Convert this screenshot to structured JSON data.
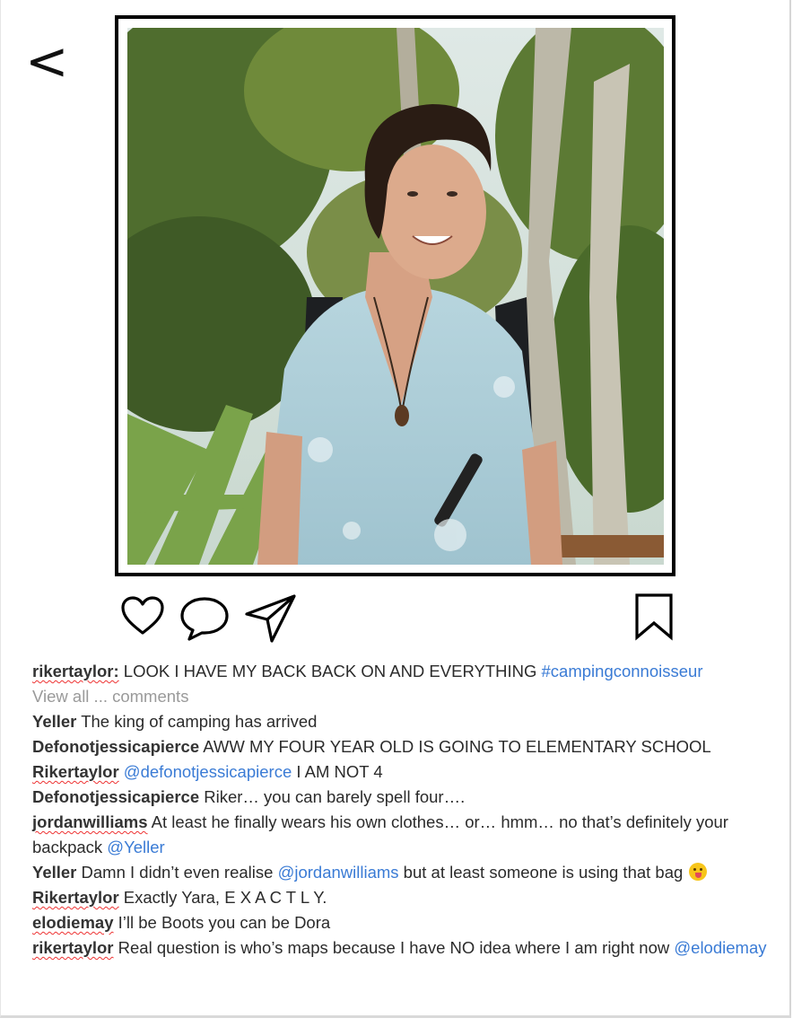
{
  "nav": {
    "back_label": "<"
  },
  "photo": {
    "subject": "Smiling man in a light blue floral shirt with a backpack in front of trees"
  },
  "actions": {
    "like_icon": "heart-icon",
    "comment_icon": "comment-bubble-icon",
    "share_icon": "paper-plane-icon",
    "save_icon": "bookmark-icon"
  },
  "caption": {
    "username": "rikertaylor:",
    "text": " LOOK I HAVE MY BACK BACK ON AND EVERYTHING ",
    "hashtag": "#campingconnoisseur"
  },
  "view_all": "View all ... comments",
  "comments": [
    {
      "user": "Yeller",
      "parts": [
        {
          "t": " The king of camping has arrived"
        }
      ]
    },
    {
      "user": "Defonotjessicapierce",
      "parts": [
        {
          "t": " AWW MY FOUR YEAR OLD IS GOING TO ELEMENTARY SCHOOL"
        }
      ]
    },
    {
      "user": "Rikertaylor",
      "parts": [
        {
          "t": " "
        },
        {
          "m": "@defonotjessicapierce"
        },
        {
          "t": " I AM NOT 4"
        }
      ]
    },
    {
      "user": "Defonotjessicapierce",
      "parts": [
        {
          "t": " Riker… you can barely spell four…."
        }
      ]
    },
    {
      "user": "jordanwilliams",
      "parts": [
        {
          "t": " At least he finally wears his own clothes… or… hmm… no that’s definitely your backpack "
        },
        {
          "m": "@Yeller"
        }
      ]
    },
    {
      "user": "Yeller",
      "parts": [
        {
          "t": " Damn I didn’t even realise "
        },
        {
          "m": "@jordanwilliams"
        },
        {
          "t": " but at least someone is using that bag "
        }
      ],
      "emoji": true
    },
    {
      "user": "Rikertaylor",
      "parts": [
        {
          "t": " Exactly Yara, E X A C T L Y."
        }
      ]
    },
    {
      "user": "elodiemay",
      "parts": [
        {
          "t": " I’ll be Boots you can be Dora"
        }
      ]
    },
    {
      "user": "rikertaylor",
      "parts": [
        {
          "t": " Real question is who’s maps because I have NO idea where I am right now "
        },
        {
          "m": "@elodiemay"
        }
      ]
    }
  ]
}
